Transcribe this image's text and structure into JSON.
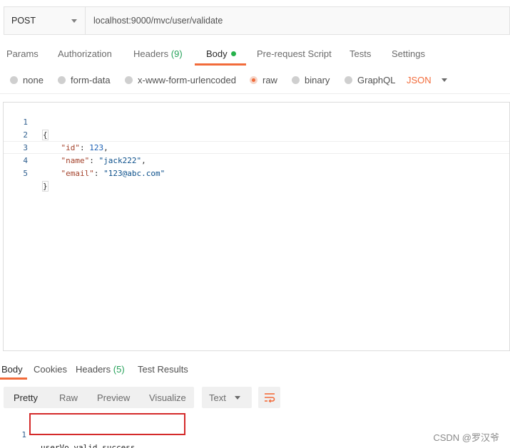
{
  "request": {
    "method": "POST",
    "url": "localhost:9000/mvc/user/validate"
  },
  "request_tabs": [
    {
      "label": "Params"
    },
    {
      "label": "Authorization"
    },
    {
      "label": "Headers",
      "count": "(9)"
    },
    {
      "label": "Body",
      "active": true
    },
    {
      "label": "Pre-request Script"
    },
    {
      "label": "Tests"
    },
    {
      "label": "Settings"
    }
  ],
  "body_options": [
    {
      "label": "none"
    },
    {
      "label": "form-data"
    },
    {
      "label": "x-www-form-urlencoded"
    },
    {
      "label": "raw",
      "selected": true
    },
    {
      "label": "binary"
    },
    {
      "label": "GraphQL"
    }
  ],
  "body_format": "JSON",
  "editor": {
    "lines": [
      {
        "num": "1",
        "brace": "{"
      },
      {
        "num": "2",
        "key": "\"id\"",
        "sep": ": ",
        "value": "123",
        "tail": ","
      },
      {
        "num": "3",
        "key": "\"name\"",
        "sep": ": ",
        "value": "\"jack222\"",
        "tail": ","
      },
      {
        "num": "4",
        "key": "\"email\"",
        "sep": ": ",
        "value": "\"123@abc.com\"",
        "tail": ""
      },
      {
        "num": "5",
        "brace": "}"
      }
    ]
  },
  "response_tabs": [
    {
      "label": "Body",
      "active": true
    },
    {
      "label": "Cookies"
    },
    {
      "label": "Headers",
      "count": "(5)"
    },
    {
      "label": "Test Results"
    }
  ],
  "response_view": {
    "modes": [
      "Pretty",
      "Raw",
      "Preview",
      "Visualize"
    ],
    "active_mode": "Pretty",
    "format": "Text"
  },
  "response_body": {
    "line_number": "1",
    "text": "userVo valid success"
  },
  "watermark": "CSDN @罗汉爷",
  "colors": {
    "accent": "#f26b3a",
    "count_green": "#26a25a",
    "highlight_red": "#d42a2a"
  }
}
